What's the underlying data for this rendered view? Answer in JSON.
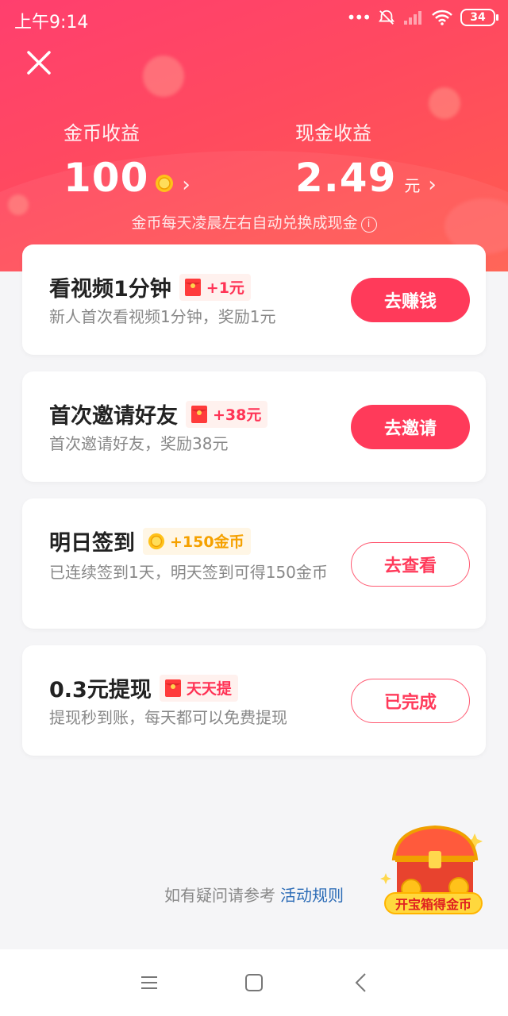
{
  "status_bar": {
    "time": "上午9:14",
    "battery": "34"
  },
  "earnings": {
    "coin_label": "金币收益",
    "coin_value": "100",
    "cash_label": "现金收益",
    "cash_value": "2.49",
    "cash_unit": "元",
    "note": "金币每天凌晨左右自动兑换成现金"
  },
  "tasks": [
    {
      "title": "看视频1分钟",
      "badge": "+1元",
      "badge_type": "redpack",
      "desc": "新人首次看视频1分钟，奖励1元",
      "button": "去赚钱",
      "button_style": "solid"
    },
    {
      "title": "首次邀请好友",
      "badge": "+38元",
      "badge_type": "redpack",
      "desc": "首次邀请好友，奖励38元",
      "button": "去邀请",
      "button_style": "solid"
    },
    {
      "title": "明日签到",
      "badge": "+150金币",
      "badge_type": "coin",
      "desc": "已连续签到1天，明天签到可得150金币",
      "button": "去查看",
      "button_style": "outline"
    },
    {
      "title": "0.3元提现",
      "badge": "天天提",
      "badge_type": "redpack",
      "desc": "提现秒到账，每天都可以免费提现",
      "button": "已完成",
      "button_style": "outline"
    }
  ],
  "footer": {
    "text": "如有疑问请参考",
    "link": "活动规则"
  },
  "treasure": {
    "label": "开宝箱得金币"
  },
  "colors": {
    "brand": "#ff3a5a",
    "link": "#2b6bb6",
    "coin": "#f5a100"
  },
  "icons": {
    "close": "close-icon",
    "coin": "coin-icon",
    "redpack": "red-envelope-icon",
    "info": "info-icon"
  }
}
